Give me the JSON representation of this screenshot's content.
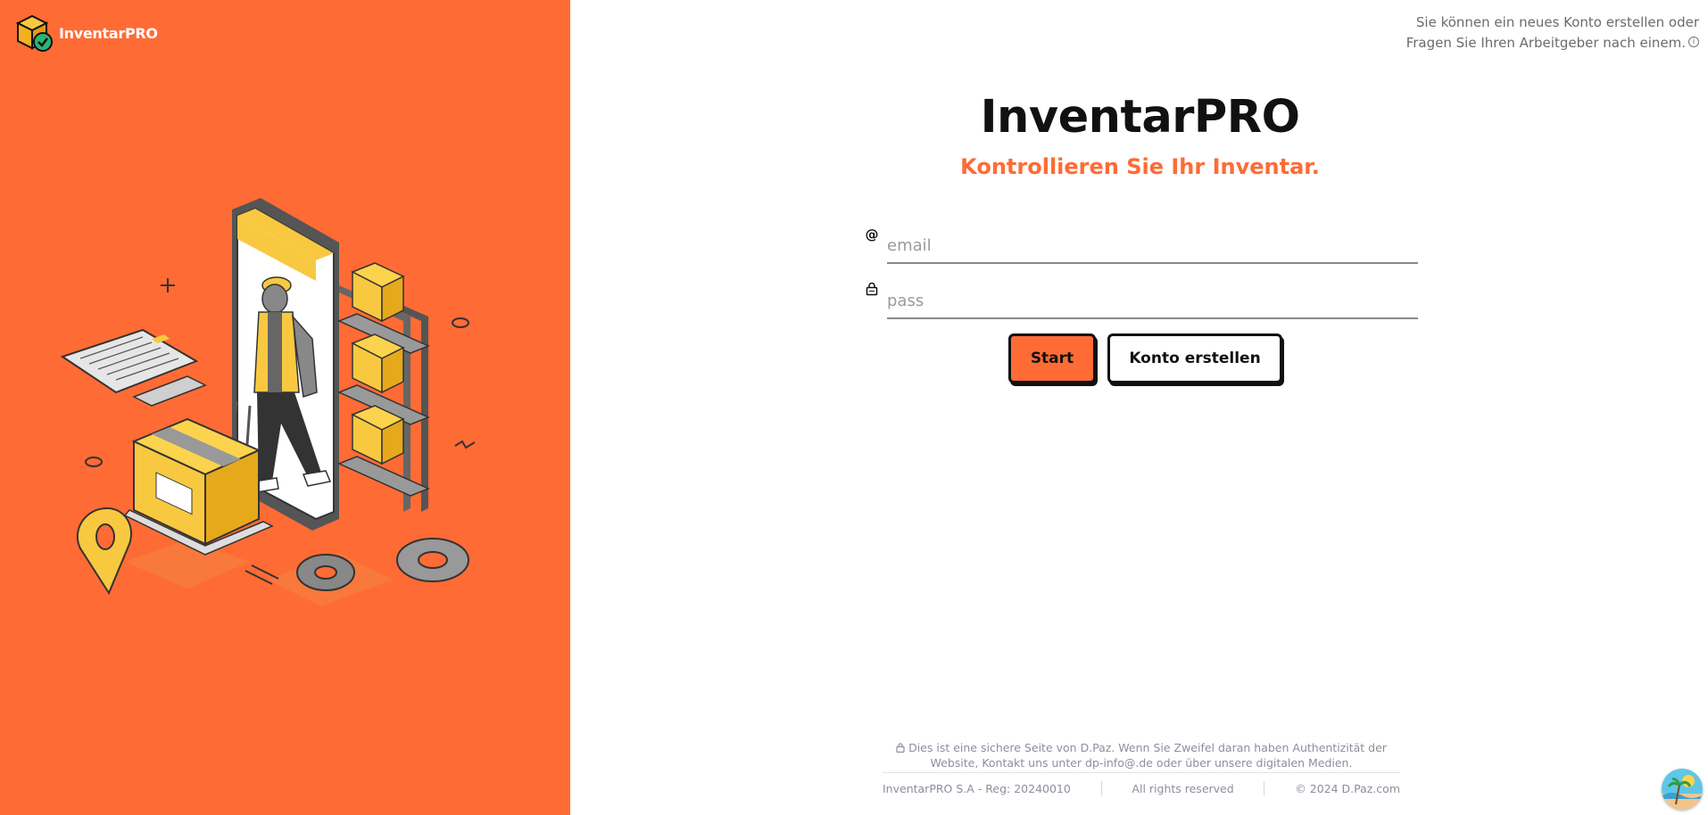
{
  "brand": {
    "name": "InventarPRO",
    "accent_color": "#FF6B35"
  },
  "top_hint": {
    "text": "Sie können ein neues Konto erstellen oder Fragen Sie Ihren Arbeitgeber nach einem.",
    "icon": "info-icon"
  },
  "login": {
    "title": "InventarPRO",
    "subtitle": "Kontrollieren Sie Ihr Inventar.",
    "email": {
      "placeholder": "email",
      "value": "",
      "icon": "at-icon"
    },
    "password": {
      "placeholder": "pass",
      "value": "",
      "icon": "lock-icon"
    },
    "start_label": "Start",
    "create_label": "Konto erstellen"
  },
  "footer": {
    "notice": "Dies ist eine sichere Seite von D.Paz. Wenn Sie Zweifel daran haben Authentizität der Website, Kontakt uns unter dp-info@.de oder über unsere digitalen Medien.",
    "registration": "InventarPRO S.A - Reg: 20240010",
    "rights": "All rights reserved",
    "copyright": "© 2024 D.Paz.com"
  }
}
